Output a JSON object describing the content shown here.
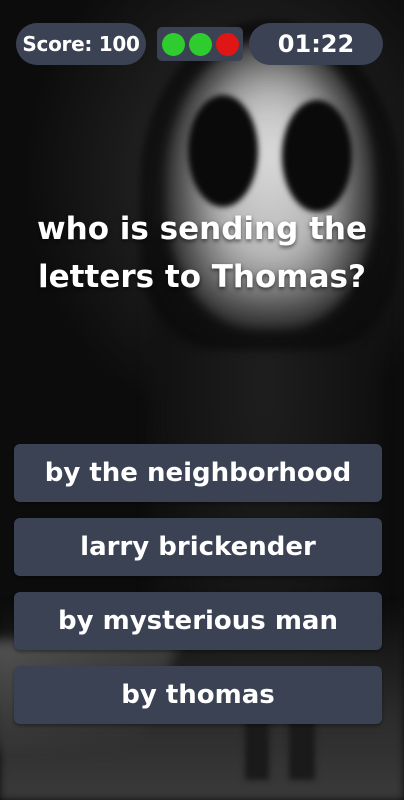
{
  "hud": {
    "score_label": "Score: 100",
    "timer": "01:22",
    "lives": [
      "#2ecc2e",
      "#2ecc2e",
      "#e01616"
    ]
  },
  "question": "who is sending the letters to Thomas?",
  "answers": [
    "by the neighborhood",
    "larry brickender",
    "by mysterious man",
    "by thomas"
  ]
}
